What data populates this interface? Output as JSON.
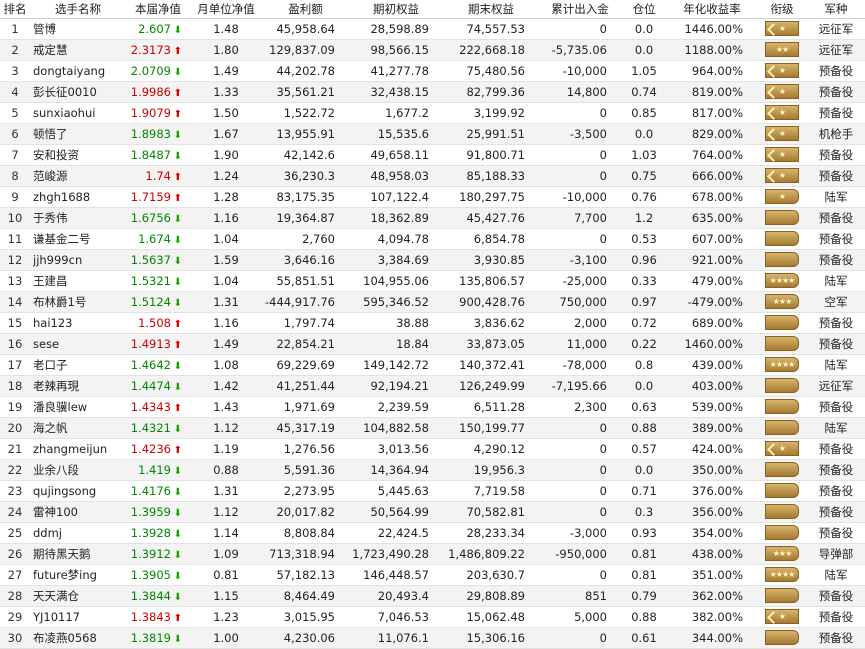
{
  "columns": [
    "排名",
    "选手名称",
    "本届净值",
    "月单位净值",
    "盈利额",
    "期初权益",
    "期末权益",
    "累计出入金",
    "仓位",
    "年化收益率",
    "衔级",
    "军种"
  ],
  "rows": [
    {
      "rank": "1",
      "name": "管博",
      "nav": "2.607",
      "nav_dir": "down",
      "monthly": "1.48",
      "profit": "45,958.64",
      "start": "28,598.89",
      "end": "74,557.53",
      "flow": "0",
      "position": "0.0",
      "annual": "1446.00%",
      "rank_badge": "double-chevron-one-star",
      "army": "远征军"
    },
    {
      "rank": "2",
      "name": "戒定慧",
      "nav": "2.3173",
      "nav_dir": "up",
      "monthly": "1.80",
      "profit": "129,837.09",
      "start": "98,566.15",
      "end": "222,668.18",
      "flow": "-5,735.06",
      "position": "0.0",
      "annual": "1188.00%",
      "rank_badge": "two-star",
      "army": "远征军"
    },
    {
      "rank": "3",
      "name": "dongtaiyang",
      "nav": "2.0709",
      "nav_dir": "down",
      "monthly": "1.49",
      "profit": "44,202.78",
      "start": "41,277.78",
      "end": "75,480.56",
      "flow": "-10,000",
      "position": "1.05",
      "annual": "964.00%",
      "rank_badge": "double-chevron-one-star",
      "army": "预备役"
    },
    {
      "rank": "4",
      "name": "彭长征0010",
      "nav": "1.9986",
      "nav_dir": "up",
      "monthly": "1.33",
      "profit": "35,561.21",
      "start": "32,438.15",
      "end": "82,799.36",
      "flow": "14,800",
      "position": "0.74",
      "annual": "819.00%",
      "rank_badge": "double-chevron-one-star",
      "army": "预备役"
    },
    {
      "rank": "5",
      "name": "sunxiaohui",
      "nav": "1.9079",
      "nav_dir": "up",
      "monthly": "1.50",
      "profit": "1,522.72",
      "start": "1,677.2",
      "end": "3,199.92",
      "flow": "0",
      "position": "0.85",
      "annual": "817.00%",
      "rank_badge": "double-chevron-one-star",
      "army": "预备役"
    },
    {
      "rank": "6",
      "name": "顿悟了",
      "nav": "1.8983",
      "nav_dir": "down",
      "monthly": "1.67",
      "profit": "13,955.91",
      "start": "15,535.6",
      "end": "25,991.51",
      "flow": "-3,500",
      "position": "0.0",
      "annual": "829.00%",
      "rank_badge": "double-chevron-one-star",
      "army": "机枪手"
    },
    {
      "rank": "7",
      "name": "安和投资",
      "nav": "1.8487",
      "nav_dir": "down",
      "monthly": "1.90",
      "profit": "42,142.6",
      "start": "49,658.11",
      "end": "91,800.71",
      "flow": "0",
      "position": "1.03",
      "annual": "764.00%",
      "rank_badge": "double-chevron-one-star",
      "army": "预备役"
    },
    {
      "rank": "8",
      "name": "范峻源",
      "nav": "1.74",
      "nav_dir": "up",
      "monthly": "1.24",
      "profit": "36,230.3",
      "start": "48,958.03",
      "end": "85,188.33",
      "flow": "0",
      "position": "0.75",
      "annual": "666.00%",
      "rank_badge": "double-chevron-one-star",
      "army": "预备役"
    },
    {
      "rank": "9",
      "name": "zhgh1688",
      "nav": "1.7159",
      "nav_dir": "up",
      "monthly": "1.28",
      "profit": "83,175.35",
      "start": "107,122.4",
      "end": "180,297.75",
      "flow": "-10,000",
      "position": "0.76",
      "annual": "678.00%",
      "rank_badge": "flag-one-star",
      "army": "陆军"
    },
    {
      "rank": "10",
      "name": "于秀伟",
      "nav": "1.6756",
      "nav_dir": "down",
      "monthly": "1.16",
      "profit": "19,364.87",
      "start": "18,362.89",
      "end": "45,427.76",
      "flow": "7,700",
      "position": "1.2",
      "annual": "635.00%",
      "rank_badge": "plain",
      "army": "预备役"
    },
    {
      "rank": "11",
      "name": "谦基金二号",
      "nav": "1.674",
      "nav_dir": "down",
      "monthly": "1.04",
      "profit": "2,760",
      "start": "4,094.78",
      "end": "6,854.78",
      "flow": "0",
      "position": "0.53",
      "annual": "607.00%",
      "rank_badge": "plain",
      "army": "预备役"
    },
    {
      "rank": "12",
      "name": "jjh999cn",
      "nav": "1.5637",
      "nav_dir": "down",
      "monthly": "1.59",
      "profit": "3,646.16",
      "start": "3,384.69",
      "end": "3,930.85",
      "flow": "-3,100",
      "position": "0.96",
      "annual": "921.00%",
      "rank_badge": "plain",
      "army": "预备役"
    },
    {
      "rank": "13",
      "name": "王建昌",
      "nav": "1.5321",
      "nav_dir": "down",
      "monthly": "1.04",
      "profit": "55,851.51",
      "start": "104,955.06",
      "end": "135,806.57",
      "flow": "-25,000",
      "position": "0.33",
      "annual": "479.00%",
      "rank_badge": "flag-four-star",
      "army": "陆军"
    },
    {
      "rank": "14",
      "name": "布林爵1号",
      "nav": "1.5124",
      "nav_dir": "down",
      "monthly": "1.31",
      "profit": "-444,917.76",
      "start": "595,346.52",
      "end": "900,428.76",
      "flow": "750,000",
      "position": "0.97",
      "annual": "-479.00%",
      "rank_badge": "flag-three-star",
      "army": "空军"
    },
    {
      "rank": "15",
      "name": "hai123",
      "nav": "1.508",
      "nav_dir": "up",
      "monthly": "1.16",
      "profit": "1,797.74",
      "start": "38.88",
      "end": "3,836.62",
      "flow": "2,000",
      "position": "0.72",
      "annual": "689.00%",
      "rank_badge": "plain",
      "army": "预备役"
    },
    {
      "rank": "16",
      "name": "sese",
      "nav": "1.4913",
      "nav_dir": "up",
      "monthly": "1.49",
      "profit": "22,854.21",
      "start": "18.84",
      "end": "33,873.05",
      "flow": "11,000",
      "position": "0.22",
      "annual": "1460.00%",
      "rank_badge": "plain",
      "army": "预备役"
    },
    {
      "rank": "17",
      "name": "老口子",
      "nav": "1.4642",
      "nav_dir": "down",
      "monthly": "1.08",
      "profit": "69,229.69",
      "start": "149,142.72",
      "end": "140,372.41",
      "flow": "-78,000",
      "position": "0.8",
      "annual": "439.00%",
      "rank_badge": "flag-four-star",
      "army": "陆军"
    },
    {
      "rank": "18",
      "name": "老辣再現",
      "nav": "1.4474",
      "nav_dir": "down",
      "monthly": "1.42",
      "profit": "41,251.44",
      "start": "92,194.21",
      "end": "126,249.99",
      "flow": "-7,195.66",
      "position": "0.0",
      "annual": "403.00%",
      "rank_badge": "plain",
      "army": "远征军"
    },
    {
      "rank": "19",
      "name": "潘良骥lew",
      "nav": "1.4343",
      "nav_dir": "up",
      "monthly": "1.43",
      "profit": "1,971.69",
      "start": "2,239.59",
      "end": "6,511.28",
      "flow": "2,300",
      "position": "0.63",
      "annual": "539.00%",
      "rank_badge": "plain",
      "army": "预备役"
    },
    {
      "rank": "20",
      "name": "海之帆",
      "nav": "1.4321",
      "nav_dir": "down",
      "monthly": "1.12",
      "profit": "45,317.19",
      "start": "104,882.58",
      "end": "150,199.77",
      "flow": "0",
      "position": "0.88",
      "annual": "389.00%",
      "rank_badge": "plain",
      "army": "陆军"
    },
    {
      "rank": "21",
      "name": "zhangmeijun",
      "nav": "1.4236",
      "nav_dir": "up",
      "monthly": "1.19",
      "profit": "1,276.56",
      "start": "3,013.56",
      "end": "4,290.12",
      "flow": "0",
      "position": "0.57",
      "annual": "424.00%",
      "rank_badge": "double-chevron-one-star",
      "army": "预备役"
    },
    {
      "rank": "22",
      "name": "业余八段",
      "nav": "1.419",
      "nav_dir": "down",
      "monthly": "0.88",
      "profit": "5,591.36",
      "start": "14,364.94",
      "end": "19,956.3",
      "flow": "0",
      "position": "0.0",
      "annual": "350.00%",
      "rank_badge": "plain",
      "army": "预备役"
    },
    {
      "rank": "23",
      "name": "qujingsong",
      "nav": "1.4176",
      "nav_dir": "down",
      "monthly": "1.31",
      "profit": "2,273.95",
      "start": "5,445.63",
      "end": "7,719.58",
      "flow": "0",
      "position": "0.71",
      "annual": "376.00%",
      "rank_badge": "plain",
      "army": "预备役"
    },
    {
      "rank": "24",
      "name": "雷神100",
      "nav": "1.3959",
      "nav_dir": "down",
      "monthly": "1.12",
      "profit": "20,017.82",
      "start": "50,564.99",
      "end": "70,582.81",
      "flow": "0",
      "position": "0.3",
      "annual": "356.00%",
      "rank_badge": "plain",
      "army": "预备役"
    },
    {
      "rank": "25",
      "name": "ddmj",
      "nav": "1.3928",
      "nav_dir": "down",
      "monthly": "1.14",
      "profit": "8,808.84",
      "start": "22,424.5",
      "end": "28,233.34",
      "flow": "-3,000",
      "position": "0.93",
      "annual": "354.00%",
      "rank_badge": "plain",
      "army": "预备役"
    },
    {
      "rank": "26",
      "name": "期待黑天鹅",
      "nav": "1.3912",
      "nav_dir": "down",
      "monthly": "1.09",
      "profit": "713,318.94",
      "start": "1,723,490.28",
      "end": "1,486,809.22",
      "flow": "-950,000",
      "position": "0.81",
      "annual": "438.00%",
      "rank_badge": "flag-three-star",
      "army": "导弹部"
    },
    {
      "rank": "27",
      "name": "future梦ing",
      "nav": "1.3905",
      "nav_dir": "down",
      "monthly": "0.81",
      "profit": "57,182.13",
      "start": "146,448.57",
      "end": "203,630.7",
      "flow": "0",
      "position": "0.81",
      "annual": "351.00%",
      "rank_badge": "flag-four-star",
      "army": "陆军"
    },
    {
      "rank": "28",
      "name": "天天满仓",
      "nav": "1.3844",
      "nav_dir": "down",
      "monthly": "1.15",
      "profit": "8,464.49",
      "start": "20,493.4",
      "end": "29,808.89",
      "flow": "851",
      "position": "0.79",
      "annual": "362.00%",
      "rank_badge": "plain",
      "army": "预备役"
    },
    {
      "rank": "29",
      "name": "YJ10117",
      "nav": "1.3843",
      "nav_dir": "up",
      "monthly": "1.23",
      "profit": "3,015.95",
      "start": "7,046.53",
      "end": "15,062.48",
      "flow": "5,000",
      "position": "0.88",
      "annual": "382.00%",
      "rank_badge": "double-chevron-one-star",
      "army": "预备役"
    },
    {
      "rank": "30",
      "name": "布凌燕0568",
      "nav": "1.3819",
      "nav_dir": "down",
      "monthly": "1.00",
      "profit": "4,230.06",
      "start": "11,076.1",
      "end": "15,306.16",
      "flow": "0",
      "position": "0.61",
      "annual": "344.00%",
      "rank_badge": "plain",
      "army": "预备役"
    }
  ]
}
